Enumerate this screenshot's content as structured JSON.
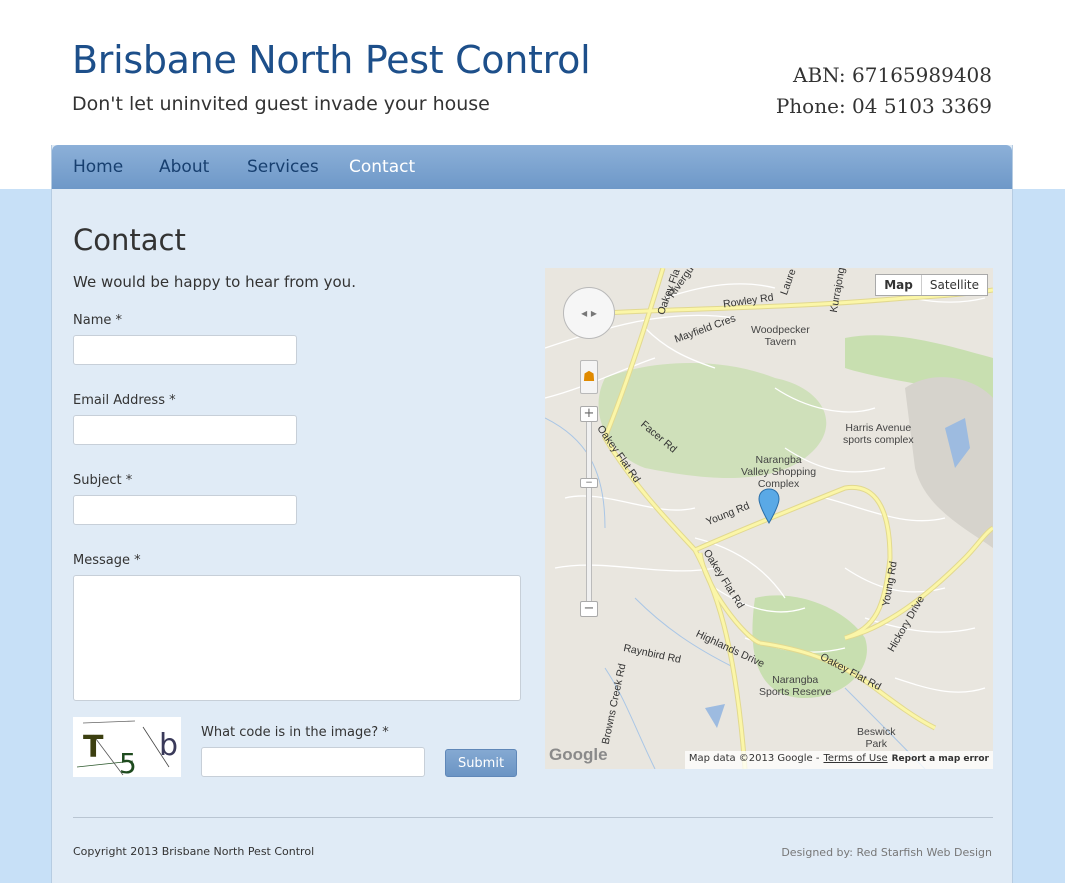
{
  "header": {
    "site_title": "Brisbane North Pest Control",
    "tagline": "Don't let uninvited guest invade your house",
    "abn": "ABN: 67165989408",
    "phone": "Phone: 04 5103 3369"
  },
  "nav": {
    "items": [
      {
        "label": "Home",
        "active": false
      },
      {
        "label": "About",
        "active": false
      },
      {
        "label": "Services",
        "active": false
      },
      {
        "label": "Contact",
        "active": true
      }
    ]
  },
  "contact": {
    "heading": "Contact",
    "intro": "We would be happy to hear from you.",
    "fields": {
      "name_label": "Name",
      "email_label": "Email Address",
      "subject_label": "Subject",
      "message_label": "Message",
      "required_marker": "*",
      "name_value": "",
      "email_value": "",
      "subject_value": "",
      "message_value": ""
    },
    "captcha": {
      "label": "What code is in the image?",
      "image_text": [
        "T",
        "5",
        "b"
      ],
      "input_value": ""
    },
    "submit_label": "Submit"
  },
  "map": {
    "type_buttons": [
      "Map",
      "Satellite"
    ],
    "selected_type": "Map",
    "attribution": "Map data ©2013 Google -",
    "terms_link": "Terms of Use",
    "report_link": "Report a map error",
    "logo": "Google",
    "places": [
      {
        "name": "Woodpecker\nTavern"
      },
      {
        "name": "Harris Avenue\nsports complex"
      },
      {
        "name": "Narangba\nValley Shopping\nComplex"
      },
      {
        "name": "Narangba\nSports Reserve"
      },
      {
        "name": "Beswick\nPark"
      }
    ],
    "roads": [
      "Rowley Rd",
      "Oakey Flat Rd",
      "Young Rd",
      "Oakey Flat Rd",
      "Young Rd",
      "Oakey Flat Rd",
      "Facer Rd",
      "Mayfield Cres",
      "Raynbird Rd",
      "Highlands Drive",
      "Hickory Drive",
      "Browns Creek Rd",
      "Kurrajong",
      "Laure",
      "Rivergu",
      "Oakey Fla"
    ],
    "colors": {
      "land": "#e9e6df",
      "park": "#c8dfb0",
      "major_road": "#fbf6a8",
      "water": "#9dbbe0",
      "pin": "#5aa9e6"
    }
  },
  "footer": {
    "copyright": "Copyright 2013 Brisbane North Pest Control",
    "designer": "Designed by: Red Starfish Web Design"
  }
}
